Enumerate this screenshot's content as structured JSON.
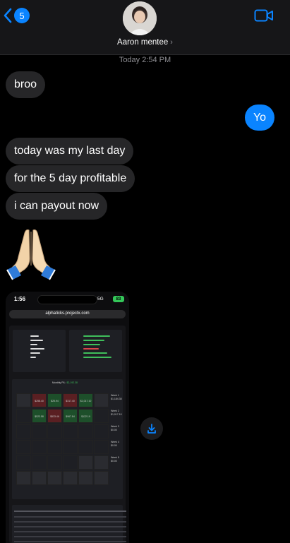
{
  "header": {
    "back_badge": "5",
    "contact_name": "Aaron mentee",
    "contact_chevron": "›",
    "icons": {
      "back": "chevron-left-icon",
      "video": "video-camera-icon"
    },
    "accent": "#0a84ff"
  },
  "thread": {
    "timestamp": "Today 2:54 PM",
    "messages": [
      {
        "from": "them",
        "text": "broo"
      },
      {
        "from": "me",
        "text": "Yo"
      },
      {
        "from": "them",
        "text": "today was my last day"
      },
      {
        "from": "them",
        "text": "for the 5 day profitable"
      },
      {
        "from": "them",
        "text": "i can payout now"
      },
      {
        "from": "them",
        "emoji": "🙏"
      }
    ]
  },
  "attachment": {
    "phone_time": "1:56",
    "phone_signal": "5G",
    "phone_battery": "83",
    "url": "alphaticks.projectx.com",
    "monthly_label": "Monthly P/L:",
    "monthly_value": "$2,192.38",
    "cells": [
      "$258.40",
      "$25.94",
      "$317.40",
      "$1,017.10",
      "$523.58",
      "$533.46",
      "$967.84",
      "$122.19"
    ],
    "weeks": [
      {
        "label": "Week 1",
        "value": "$1,184.38"
      },
      {
        "label": "Week 2",
        "value": "$1,017.10"
      },
      {
        "label": "Week 3",
        "value": "$0.00"
      },
      {
        "label": "Week 4",
        "value": "$0.00"
      },
      {
        "label": "Week 5",
        "value": "$0.00"
      }
    ]
  },
  "download_icon": "download-icon"
}
